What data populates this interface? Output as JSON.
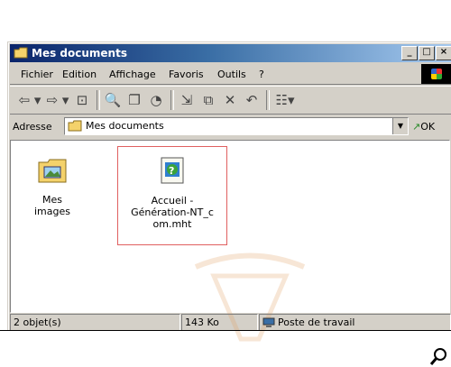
{
  "window": {
    "title": "Mes documents",
    "buttons": [
      "_",
      "□",
      "×"
    ]
  },
  "menu": {
    "items": [
      "Fichier",
      "Edition",
      "Affichage",
      "Favoris",
      "Outils",
      "?"
    ]
  },
  "toolbar": {
    "icons": [
      "back-icon",
      "forward-icon",
      "up-folder-icon",
      "search-icon",
      "folders-icon",
      "history-icon",
      "move-to-icon",
      "copy-to-icon",
      "delete-icon",
      "undo-icon",
      "views-icon"
    ]
  },
  "address": {
    "label": "Adresse",
    "value": "Mes documents",
    "go_label": "OK"
  },
  "files": [
    {
      "name": "Mes images",
      "type": "folder"
    },
    {
      "name": "Accueil - Génération-NT_com.mht",
      "line1": "Accueil -",
      "line2": "Génération-NT_c",
      "line3": "om.mht",
      "type": "mht",
      "selected": true
    }
  ],
  "status": {
    "count": "2 objet(s)",
    "size": "143 Ko",
    "location": "Poste de travail"
  }
}
